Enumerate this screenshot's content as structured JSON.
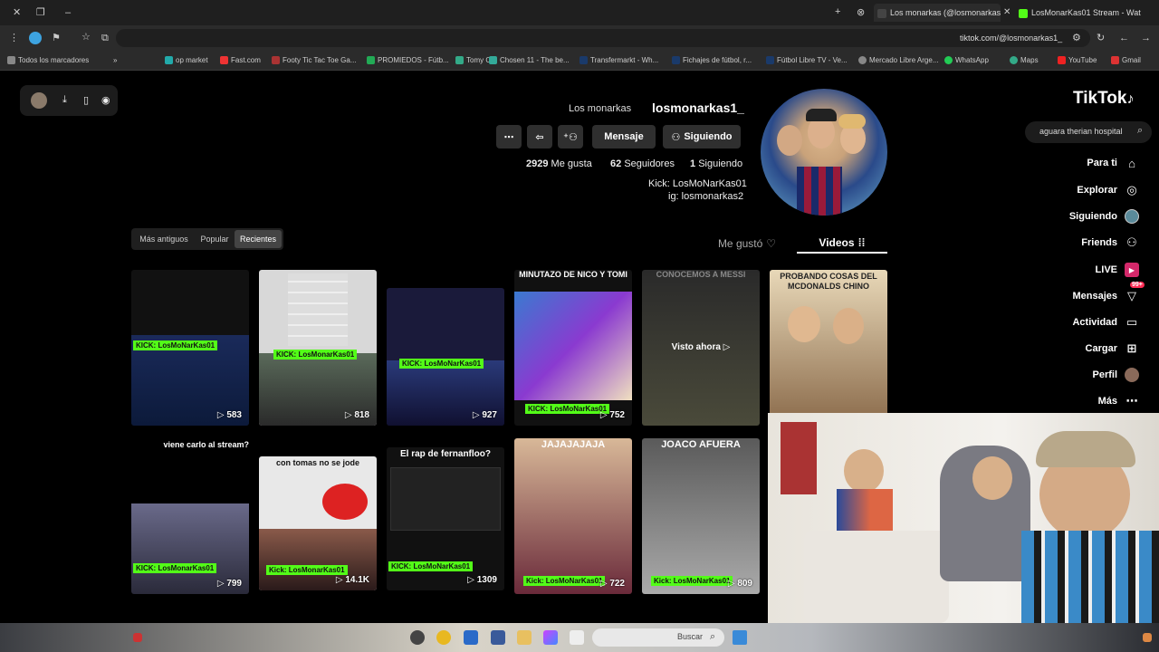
{
  "browser": {
    "tabs": [
      {
        "label": "LosMonarKas01 Stream - Wat",
        "color": "#53fc18"
      },
      {
        "label": "Los monarkas (@losmonarkas",
        "color": "#222"
      }
    ],
    "url": "tiktok.com/@losmonarkas1_",
    "bookmarks": [
      "Todos los marcadores",
      "Fast.com",
      "op market",
      "Footy Tic Tac Toe Ga...",
      "PROMIEDOS - Fútb...",
      "Tomy C",
      "Chosen 11 - The be...",
      "Transfermarkt - Wh...",
      "Fichajes de fútbol, r...",
      "Fútbol Libre TV - Ve...",
      "Mercado Libre Arge...",
      "WhatsApp",
      "Maps",
      "YouTube",
      "Gmail"
    ]
  },
  "sidebar": {
    "logo": "TikTok",
    "search_value": "aguara therian hospital",
    "items": [
      {
        "label": "Para ti",
        "icon": "home-icon"
      },
      {
        "label": "Explorar",
        "icon": "compass-icon"
      },
      {
        "label": "Siguiendo",
        "icon": "avatar-icon"
      },
      {
        "label": "Friends",
        "icon": "friends-icon"
      },
      {
        "label": "LIVE",
        "icon": "live-icon"
      },
      {
        "label": "Mensajes",
        "icon": "inbox-icon",
        "badge": "99+"
      },
      {
        "label": "Actividad",
        "icon": "message-icon"
      },
      {
        "label": "Cargar",
        "icon": "plus-icon"
      },
      {
        "label": "Perfil",
        "icon": "profile-icon"
      },
      {
        "label": "Más",
        "icon": "more-icon"
      }
    ]
  },
  "profile": {
    "username": "losmonarkas1_",
    "display_name": "Los monarkas",
    "following_count": "1",
    "following_label": "Siguiendo",
    "followers_count": "62",
    "followers_label": "Seguidores",
    "likes_count": "2929",
    "likes_label": "Me gusta",
    "bio_line1": "Kick: LosMoNarKas01",
    "bio_line2": "ig: losmonarkas2",
    "btn_following": "Siguiendo",
    "btn_message": "Mensaje"
  },
  "tabs": {
    "videos": "Videos",
    "liked": "Me gustó"
  },
  "sort": {
    "recent": "Recientes",
    "popular": "Popular",
    "oldest": "Más antiguos"
  },
  "videos": [
    {
      "views": "583",
      "caption": "",
      "kick": "KICK: LosMoNarKas01",
      "bg": "#1a2a5a"
    },
    {
      "views": "818",
      "caption": "",
      "kick": "KICK: LosMonarKas01",
      "bg": "#c8c8c8"
    },
    {
      "views": "927",
      "caption": "",
      "kick": "KICK: LosMoNarKas01",
      "bg": "#1a1a3a"
    },
    {
      "views": "752",
      "caption": "MINUTAZO DE NICO Y TOMI",
      "kick": "KICK: LosMoNarKas01",
      "bg": "#4a2a8a"
    },
    {
      "views": "",
      "caption": "CONOCEMOS A MESSI",
      "overlay": "Visto ahora",
      "kick": "",
      "bg": "#3a3a3a"
    },
    {
      "views": "",
      "caption": "PROBANDO COSAS DEL MCDONALDS CHINO",
      "kick": "",
      "bg": "#d8c8a8"
    },
    {
      "views": "799",
      "caption": "viene carlo al stream?",
      "kick": "KICK: LosMonarKas01",
      "bg": "#444"
    },
    {
      "views": "14.1K",
      "caption": "con tomas no se jode",
      "kick": "Kick: LosMonarKas01",
      "bg": "#e8e8e8"
    },
    {
      "views": "1309",
      "caption": "El rap de fernanfloo?",
      "kick": "KICK: LosMoNarKas01",
      "bg": "#1a1a1a"
    },
    {
      "views": "722",
      "caption": "JAJAJAJAJA",
      "kick": "Kick: LosMoNarKas01",
      "bg": "#6a2a3a"
    },
    {
      "views": "809",
      "caption": "JOACO AFUERA",
      "kick": "Kick: LosMoNarKas01",
      "bg": "#8a8a8a"
    }
  ],
  "taskbar": {
    "search_placeholder": "Buscar"
  }
}
